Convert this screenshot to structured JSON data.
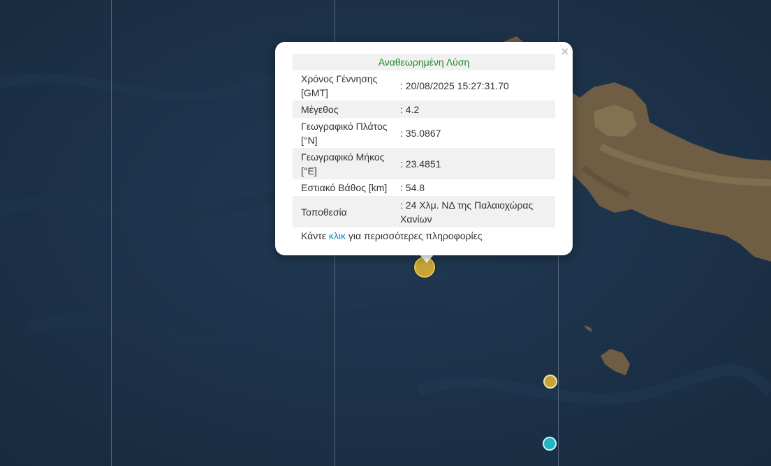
{
  "map": {
    "markers": [
      {
        "name": "selected-earthquake",
        "color": "#c7a437",
        "size": "large"
      },
      {
        "name": "earthquake",
        "color": "#c7a437",
        "size": "small"
      },
      {
        "name": "earthquake",
        "color": "#1fb5c2",
        "size": "small"
      }
    ]
  },
  "popup": {
    "title": "Αναθεωρημένη Λύση",
    "close": "×",
    "rows": [
      {
        "label": "Χρόνος Γέννησης [GMT]",
        "value": ": 20/08/2025 15:27:31.70"
      },
      {
        "label": "Μέγεθος",
        "value": ": 4.2"
      },
      {
        "label": "Γεωγραφικό Πλάτος [°N]",
        "value": ": 35.0867"
      },
      {
        "label": "Γεωγραφικό Μήκος [°E]",
        "value": ": 23.4851"
      },
      {
        "label": "Εστιακό Βάθος [km]",
        "value": ": 54.8"
      },
      {
        "label": "Τοποθεσία",
        "value": ": 24 Χλμ. ΝΔ της Παλαιοχώρας Χανίων"
      }
    ],
    "footer_pre": "Κάντε ",
    "footer_link": "κλικ",
    "footer_post": " για περισσότερες πληροφορίες"
  },
  "colors": {
    "title": "#1f8a2a",
    "link": "#1a7fb0"
  }
}
